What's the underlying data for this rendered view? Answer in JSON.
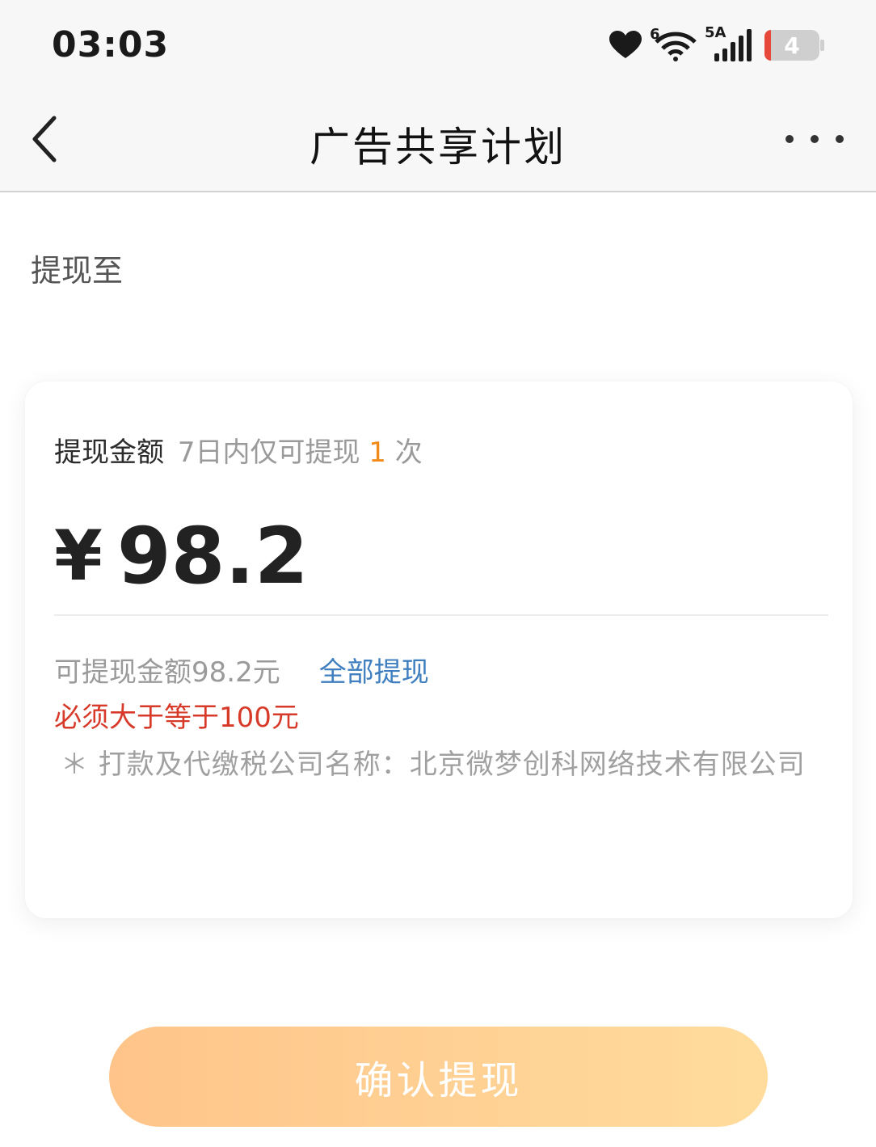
{
  "status_bar": {
    "time": "03:03",
    "wifi_badge": "6",
    "signal_badge": "5A",
    "battery_level": "4",
    "icons": [
      "heart-icon",
      "wifi-icon",
      "signal-icon",
      "battery-icon"
    ]
  },
  "nav": {
    "title": "广告共享计划",
    "back_icon": "chevron-left-icon",
    "more_icon": "more-dots-icon"
  },
  "withdraw_to_label": "提现至",
  "card": {
    "amount_label": "提现金额",
    "limit_hint_prefix": "7日内仅可提现",
    "limit_count": "1",
    "limit_hint_suffix": "次",
    "currency": "¥",
    "amount": "98.2",
    "available_text": "可提现金额98.2元",
    "withdraw_all_label": "全部提现",
    "error_text": "必须大于等于100元",
    "company_note": "＊ 打款及代缴税公司名称：北京微梦创科网络技术有限公司"
  },
  "confirm_button_label": "确认提现",
  "colors": {
    "accent_orange": "#f28a1a",
    "link_blue": "#3f7fc0",
    "error_red": "#d83a2a",
    "button_gradient_start": "#ffc48a",
    "button_gradient_end": "#ffdc9c"
  }
}
